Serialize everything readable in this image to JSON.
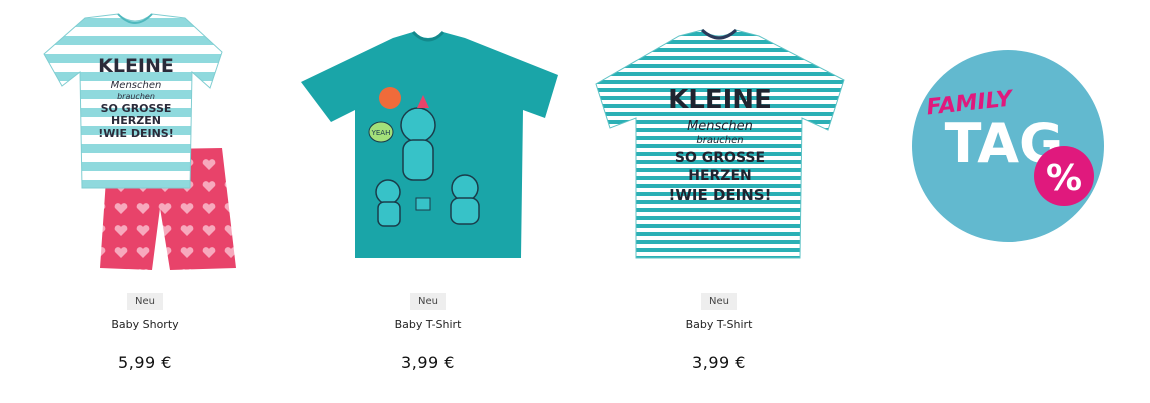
{
  "products": [
    {
      "badge": "Neu",
      "name": "Baby Shorty",
      "price": "5,99 €",
      "print_lines": [
        "KLEINE",
        "Menschen",
        "brauchen",
        "SO GROSSE",
        "HERZEN",
        "!WIE DEINS!"
      ]
    },
    {
      "badge": "Neu",
      "name": "Baby T-Shirt",
      "price": "3,99 €",
      "print_lines": [
        "YEAH"
      ]
    },
    {
      "badge": "Neu",
      "name": "Baby T-Shirt",
      "price": "3,99 €",
      "print_lines": [
        "KLEINE",
        "Menschen",
        "brauchen",
        "SO GROSSE",
        "HERZEN",
        "!WIE DEINS!"
      ]
    }
  ],
  "promo": {
    "line1": "FAMILY",
    "line2": "TAG",
    "symbol": "%"
  },
  "colors": {
    "stripe_light": "#8fd9dd",
    "stripe_teal": "#2bb0b5",
    "shirt_teal": "#1aa5a8",
    "shorts_pink": "#e8436a",
    "promo_circle": "#62b9cf",
    "promo_pink": "#e0197d"
  }
}
